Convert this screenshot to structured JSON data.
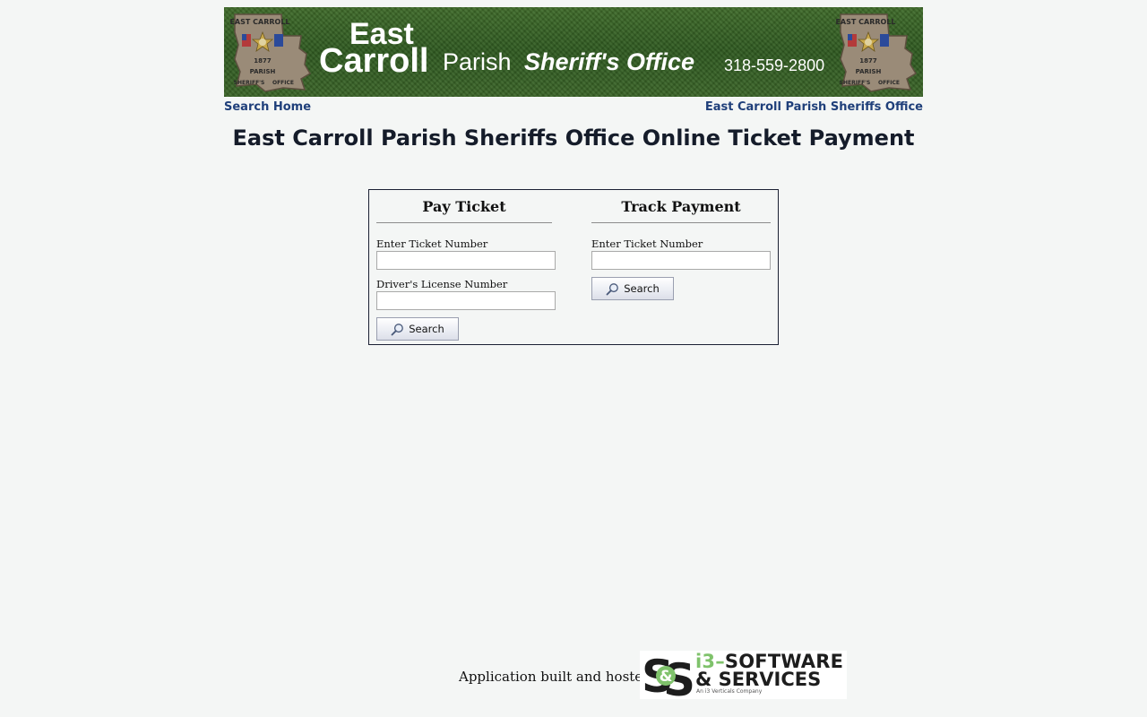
{
  "banner": {
    "line1": "East",
    "line2": "Carroll",
    "parish": "Parish",
    "sheriff": "Sheriff's Office",
    "phone": "318-559-2800",
    "seal_top_text": "EAST CARROLL",
    "seal_year": "1877",
    "seal_parish": "PARISH",
    "seal_bottom_left": "SHERIFF'S",
    "seal_bottom_right": "OFFICE"
  },
  "nav": {
    "left_link": "Search Home",
    "right_link": "East Carroll Parish Sheriffs Office"
  },
  "page_title": "East Carroll Parish Sheriffs Office Online Ticket Payment",
  "pay_ticket": {
    "title": "Pay Ticket",
    "ticket_label": "Enter Ticket Number",
    "ticket_value": "",
    "license_label": "Driver's License Number",
    "license_value": "",
    "button_label": "Search"
  },
  "track_payment": {
    "title": "Track Payment",
    "ticket_label": "Enter Ticket Number",
    "ticket_value": "",
    "button_label": "Search"
  },
  "footer": {
    "text": "Application built and hosted by",
    "logo_i3": "i3",
    "logo_dash": "–",
    "logo_software": "SOFTWARE",
    "logo_services": "& SERVICES",
    "logo_tagline": "An i3 Verticals Company"
  },
  "colors": {
    "page_bg": "#f4f6f5",
    "link": "#1f3f7a",
    "banner_green": "#3b6528",
    "logo_green": "#7fc26b"
  }
}
